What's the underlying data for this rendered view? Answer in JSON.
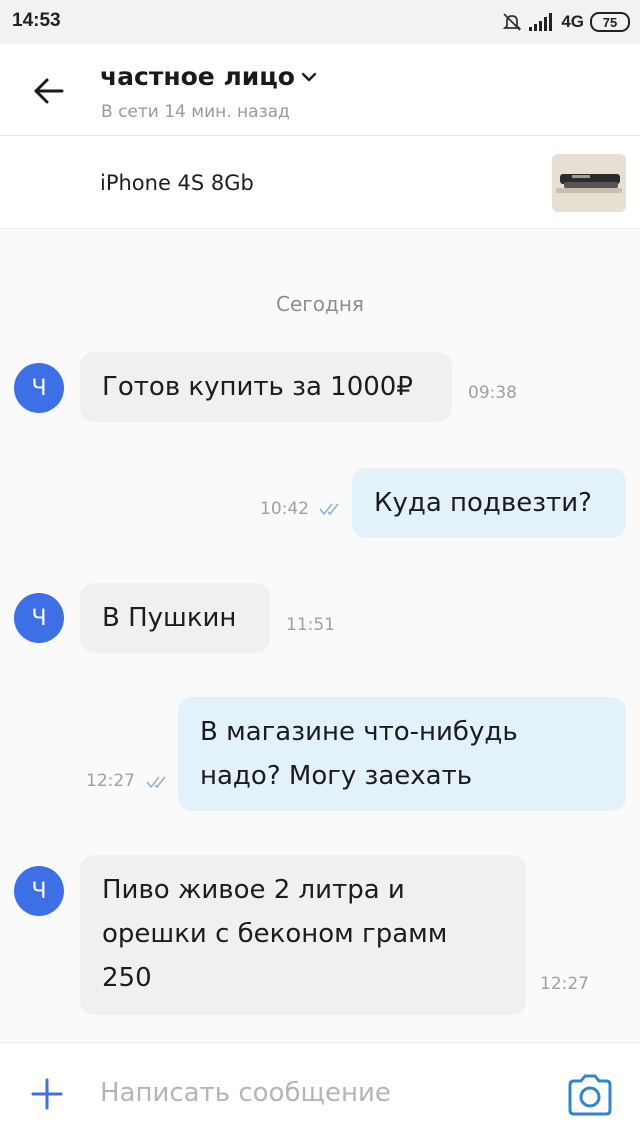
{
  "status_bar": {
    "time": "14:53",
    "network": "4G",
    "battery": "75"
  },
  "header": {
    "contact_name": "частное лицо",
    "last_seen": "В сети 14 мин. назад"
  },
  "listing": {
    "title": "iPhone 4S 8Gb"
  },
  "chat": {
    "date_separator": "Сегодня",
    "messages": [
      {
        "direction": "in",
        "avatar": "Ч",
        "lines": [
          "Готов купить за 1000₽"
        ],
        "time": "09:38"
      },
      {
        "direction": "out",
        "lines": [
          "Куда подвезти?"
        ],
        "time": "10:42",
        "status": "read"
      },
      {
        "direction": "in",
        "avatar": "Ч",
        "lines": [
          "В Пушкин"
        ],
        "time": "11:51"
      },
      {
        "direction": "out",
        "lines": [
          "В магазине что-нибудь",
          "надо? Могу заехать"
        ],
        "time": "12:27",
        "status": "read"
      },
      {
        "direction": "in",
        "avatar": "Ч",
        "lines": [
          "Пиво живое 2 литра и",
          "орешки с беконом грамм",
          "250"
        ],
        "time": "12:27"
      }
    ]
  },
  "composer": {
    "placeholder": "Написать сообщение"
  },
  "colors": {
    "accent": "#3d6fe6",
    "incoming_bubble": "#f0f0f0",
    "outgoing_bubble": "#e3f1fb",
    "chat_background": "#fafafa"
  },
  "icons": [
    "back-arrow-icon",
    "chevron-down-icon",
    "camera-icon",
    "plus-icon",
    "double-check-icon",
    "mute-icon",
    "signal-icon"
  ]
}
